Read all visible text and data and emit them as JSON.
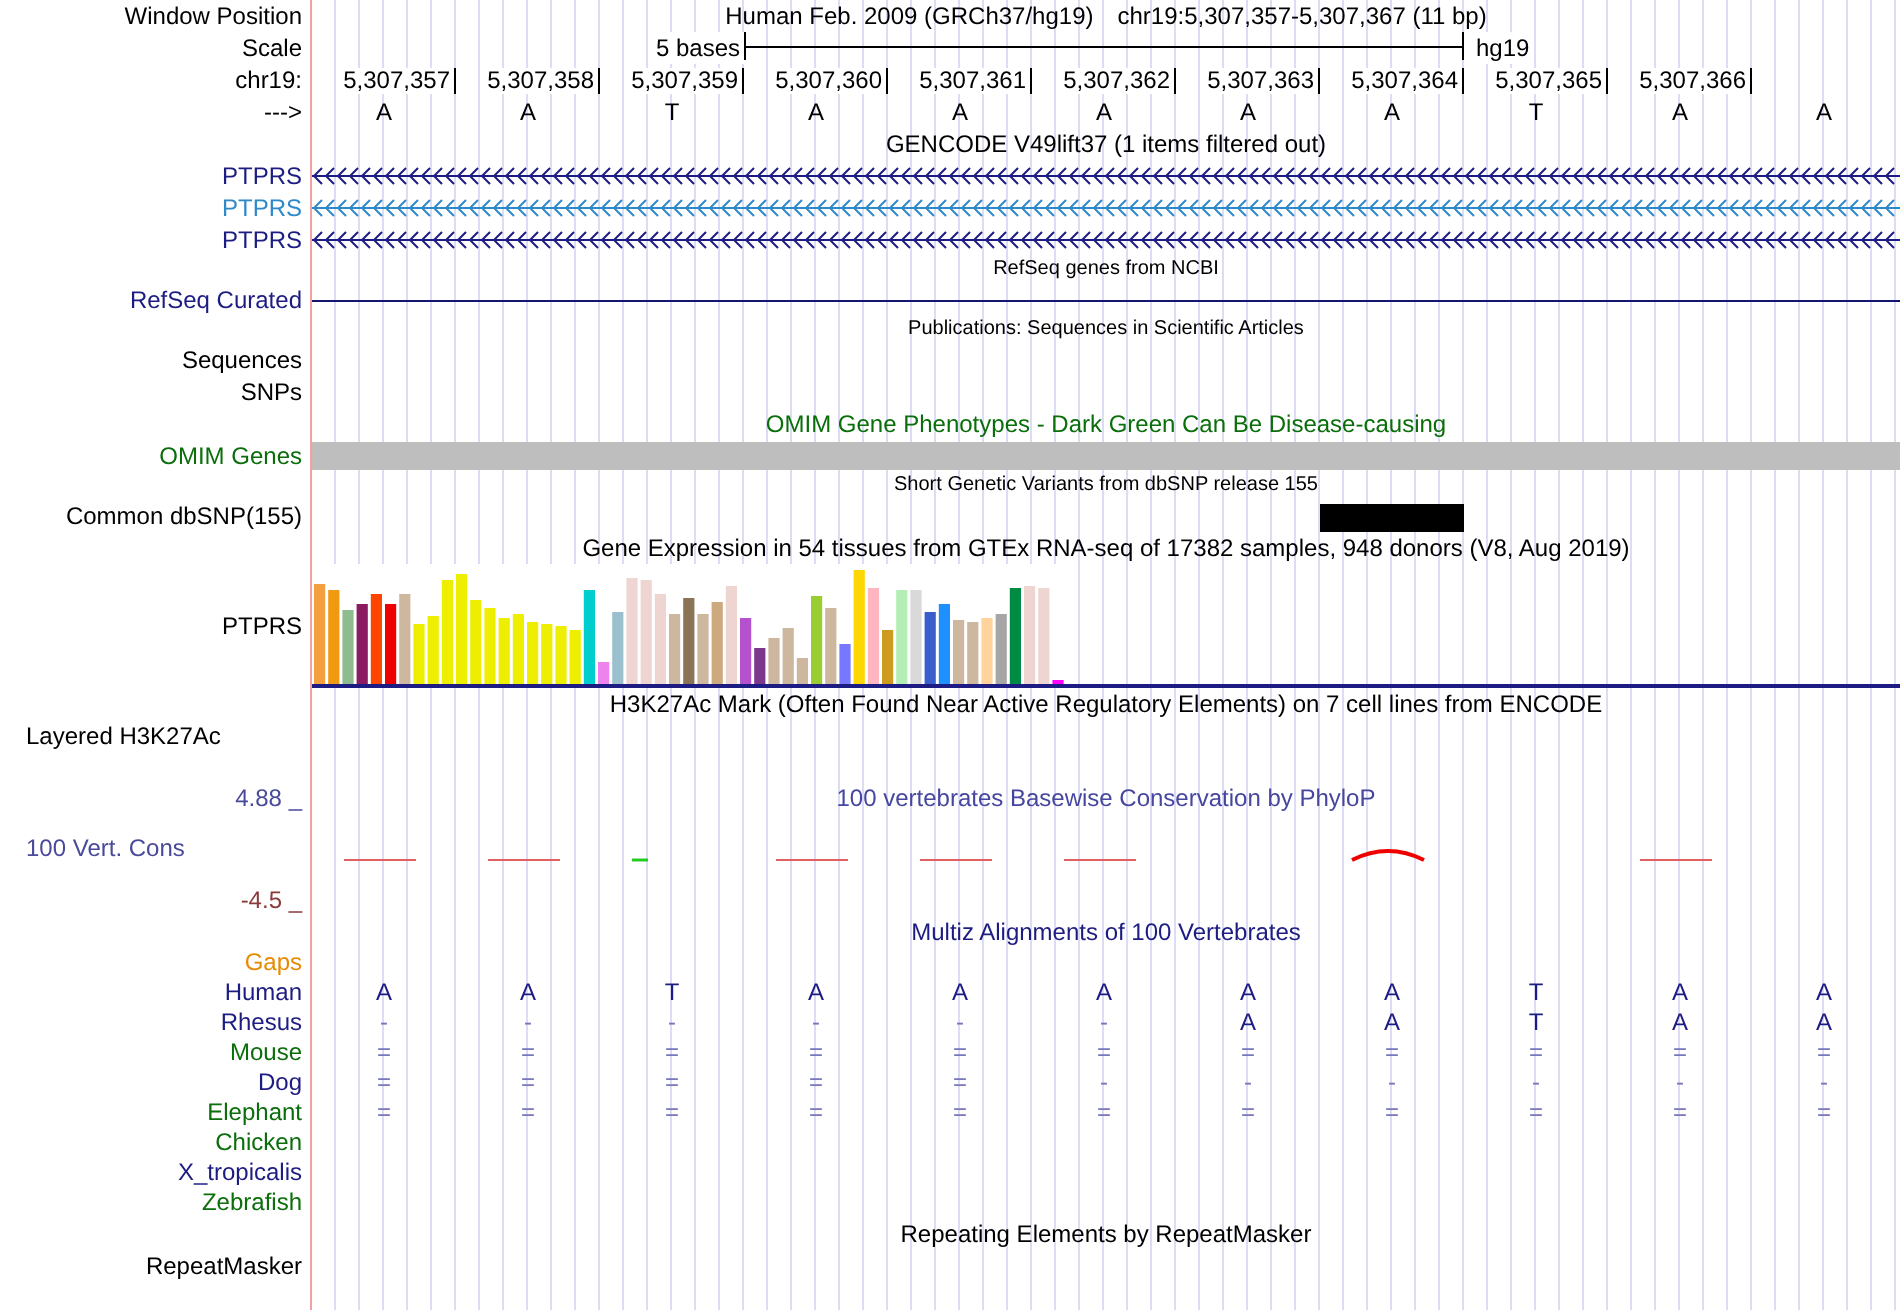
{
  "header": {
    "window_position_label": "Window Position",
    "assembly": "Human Feb. 2009 (GRCh37/hg19)",
    "position": "chr19:5,307,357-5,307,367 (11 bp)",
    "scale_label": "Scale",
    "scale_text": "5 bases",
    "scale_db": "hg19",
    "chrom_label": "chr19:",
    "strand_label": "--->"
  },
  "bases": [
    {
      "coordinate": "5,307,357",
      "base": "A",
      "common_snp": false
    },
    {
      "coordinate": "5,307,358",
      "base": "A",
      "common_snp": false
    },
    {
      "coordinate": "5,307,359",
      "base": "T",
      "common_snp": false
    },
    {
      "coordinate": "5,307,360",
      "base": "A",
      "common_snp": false
    },
    {
      "coordinate": "5,307,361",
      "base": "A",
      "common_snp": false
    },
    {
      "coordinate": "5,307,362",
      "base": "A",
      "common_snp": false
    },
    {
      "coordinate": "5,307,363",
      "base": "A",
      "common_snp": false
    },
    {
      "coordinate": "5,307,364",
      "base": "A",
      "common_snp": true
    },
    {
      "coordinate": "5,307,365",
      "base": "T",
      "common_snp": false
    },
    {
      "coordinate": "5,307,366",
      "base": "A",
      "common_snp": false
    },
    {
      "base": "A",
      "common_snp": false
    }
  ],
  "tracks": [
    {
      "kind": "genes",
      "title": "GENCODE V49lift37 (1 items filtered out)",
      "genes": [
        {
          "name": "PTPRS",
          "color": "#1c1c82"
        },
        {
          "name": "PTPRS",
          "color": "#2f88c8"
        },
        {
          "name": "PTPRS",
          "color": "#1c1c82"
        }
      ]
    },
    {
      "kind": "line",
      "title": "RefSeq genes from NCBI",
      "label": "RefSeq Curated"
    },
    {
      "kind": "empty",
      "title": "Publications: Sequences in Scientific Articles",
      "labels": [
        "Sequences",
        "SNPs"
      ]
    },
    {
      "kind": "bar",
      "title": "OMIM Gene Phenotypes - Dark Green Can Be Disease-causing",
      "label": "OMIM Genes"
    },
    {
      "kind": "snp",
      "title": "Short Genetic Variants from dbSNP release 155",
      "label": "Common dbSNP(155)"
    },
    {
      "kind": "expression",
      "title": "Gene Expression in 54 tissues from GTEx RNA-seq of 17382 samples, 948 donors (V8, Aug 2019)",
      "label": "PTPRS"
    },
    {
      "kind": "layered",
      "title": "H3K27Ac Mark (Often Found Near Active Regulatory Elements) on 7 cell lines from ENCODE",
      "label": "Layered H3K27Ac"
    },
    {
      "kind": "conservation",
      "title": "100 vertebrates Basewise Conservation by PhyloP",
      "label": "100 Vert. Cons",
      "max": "4.88 _",
      "min": "-4.5 _"
    },
    {
      "kind": "alignment",
      "title": "Multiz Alignments of 100 Vertebrates",
      "gaps_label": "Gaps",
      "species": [
        {
          "name": "Human",
          "color": "#1c1c82",
          "row": [
            "A",
            "A",
            "T",
            "A",
            "A",
            "A",
            "A",
            "A",
            "T",
            "A",
            "A"
          ]
        },
        {
          "name": "Rhesus",
          "color": "#1c1c82",
          "row": [
            "-",
            "-",
            "-",
            "-",
            "-",
            "-",
            "A",
            "A",
            "T",
            "A",
            "A"
          ]
        },
        {
          "name": "Mouse",
          "color": "#0a6e0a",
          "row": [
            "=",
            "=",
            "=",
            "=",
            "=",
            "=",
            "=",
            "=",
            "=",
            "=",
            "="
          ]
        },
        {
          "name": "Dog",
          "color": "#1c1c82",
          "row": [
            "=",
            "=",
            "=",
            "=",
            "=",
            "-",
            "-",
            "-",
            "-",
            "-",
            "-"
          ]
        },
        {
          "name": "Elephant",
          "color": "#0a6e0a",
          "row": [
            "=",
            "=",
            "=",
            "=",
            "=",
            "=",
            "=",
            "=",
            "=",
            "=",
            "="
          ]
        },
        {
          "name": "Chicken",
          "color": "#0a6e0a"
        },
        {
          "name": "X_tropicalis",
          "color": "#1c1c82"
        },
        {
          "name": "Zebrafish",
          "color": "#0a6e0a"
        }
      ]
    },
    {
      "kind": "repeats",
      "title": "Repeating Elements by RepeatMasker",
      "label": "RepeatMasker"
    }
  ]
}
